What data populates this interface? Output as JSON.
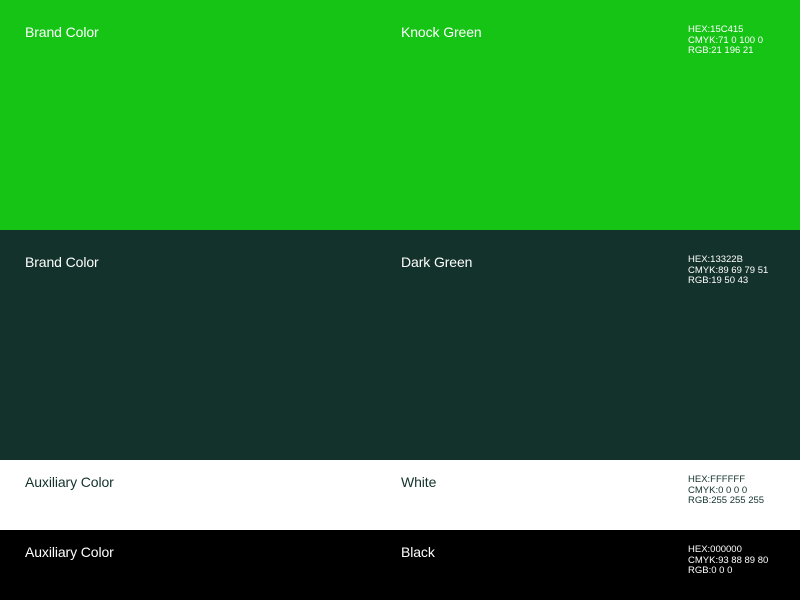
{
  "swatches": [
    {
      "category": "Brand Color",
      "name": "Knock Green",
      "hex": "HEX:15C415",
      "cmyk": "CMYK:71 0 100 0",
      "rgb": "RGB:21 196 21",
      "background": "#15C415",
      "text_color": "#FFFFFF"
    },
    {
      "category": "Brand Color",
      "name": "Dark Green",
      "hex": "HEX:13322B",
      "cmyk": "CMYK:89 69 79 51",
      "rgb": "RGB:19 50 43",
      "background": "#13322B",
      "text_color": "#FFFFFF"
    },
    {
      "category": "Auxiliary Color",
      "name": "White",
      "hex": "HEX:FFFFFF",
      "cmyk": "CMYK:0 0 0 0",
      "rgb": "RGB:255 255 255",
      "background": "#FFFFFF",
      "text_color": "#13322B"
    },
    {
      "category": "Auxiliary Color",
      "name": "Black",
      "hex": "HEX:000000",
      "cmyk": "CMYK:93 88 89 80",
      "rgb": "RGB:0 0 0",
      "background": "#000000",
      "text_color": "#FFFFFF"
    }
  ]
}
